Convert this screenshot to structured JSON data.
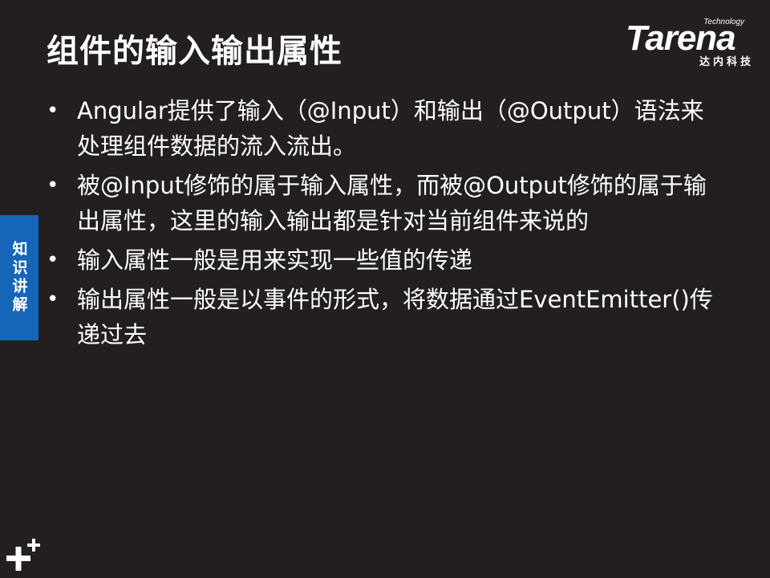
{
  "slide": {
    "title": "组件的输入输出属性",
    "logo": {
      "tagline": "Technology",
      "wordmark": "Tarena",
      "subtitle": "达内科技"
    },
    "side_tab": {
      "label": "知识讲解"
    },
    "bullets": [
      {
        "marker": "•",
        "text": "Angular提供了输入（@Input）和输出（@Output）语法来处理组件数据的流入流出。"
      },
      {
        "marker": "•",
        "text": "被@Input修饰的属于输入属性，而被@Output修饰的属于输出属性，这里的输入输出都是针对当前组件来说的"
      },
      {
        "marker": "•",
        "text": "输入属性一般是用来实现一些值的传递"
      },
      {
        "marker": "•",
        "text": "输出属性一般是以事件的形式，将数据通过EventEmitter()传递过去"
      }
    ]
  },
  "colors": {
    "background": "#231f20",
    "side_tab": "#1565b8",
    "text": "#ffffff"
  },
  "icons": {
    "corner": "plus-icon"
  }
}
